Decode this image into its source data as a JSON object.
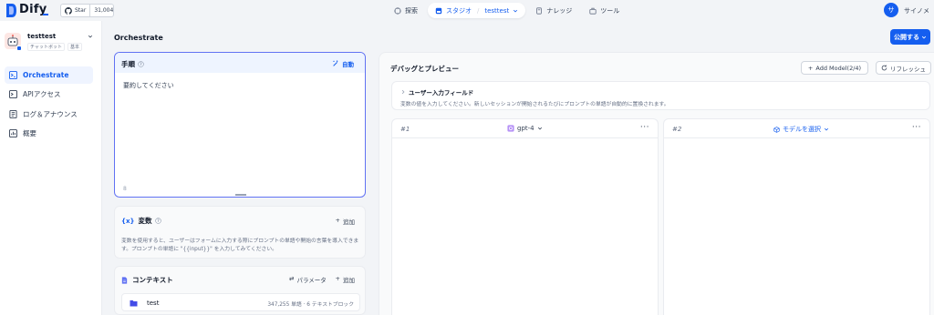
{
  "brand": {
    "name": "Dify",
    "accent": "#155eef"
  },
  "github": {
    "star_label": "Star",
    "star_count": "31,004"
  },
  "nav": {
    "explore": "探索",
    "studio": "スタジオ",
    "app": "testtest",
    "knowledge": "ナレッジ",
    "tools": "ツール"
  },
  "user": {
    "initial": "サ",
    "name": "サイノメ"
  },
  "sidebar": {
    "app_name": "testtest",
    "app_type": "チャットボット",
    "app_mode": "基本",
    "items": [
      {
        "label": "Orchestrate",
        "icon": "terminal-icon",
        "active": true
      },
      {
        "label": "APIアクセス",
        "icon": "api-icon",
        "active": false
      },
      {
        "label": "ログ＆アナウンス",
        "icon": "log-icon",
        "active": false
      },
      {
        "label": "概要",
        "icon": "chart-icon",
        "active": false
      }
    ]
  },
  "header": {
    "title": "Orchestrate",
    "publish_label": "公開する"
  },
  "prompt": {
    "title": "手順",
    "auto_label": "自動",
    "text": "要約してください",
    "count": "8"
  },
  "variables": {
    "code": "{x}",
    "title": "変数",
    "add_label": "追加",
    "description": "変数を使用すると、ユーザーはフォームに入力する際にプロンプトの単語や開始の言葉を導入できます。プロンプトの単語に \"{{input}}\" を入力してみてください。"
  },
  "context": {
    "title": "コンテキスト",
    "params_label": "パラメータ",
    "add_label": "追加",
    "item": {
      "name": "test",
      "meta": "347,255 単語 · 6 テキストブロック"
    }
  },
  "debug": {
    "title": "デバッグとプレビュー",
    "add_model_label": "Add Model(2/4)",
    "refresh_label": "リフレッシュ",
    "input_title": "ユーザー入力フィールド",
    "input_desc": "変数の値を入力してください。新しいセッションが開始されるたびにプロンプトの単語が自動的に置換されます。",
    "models": [
      {
        "num": "#1",
        "label": "gpt-4",
        "dots": "···"
      },
      {
        "num": "#2",
        "label": "モデルを選択",
        "dots": "···"
      }
    ]
  }
}
